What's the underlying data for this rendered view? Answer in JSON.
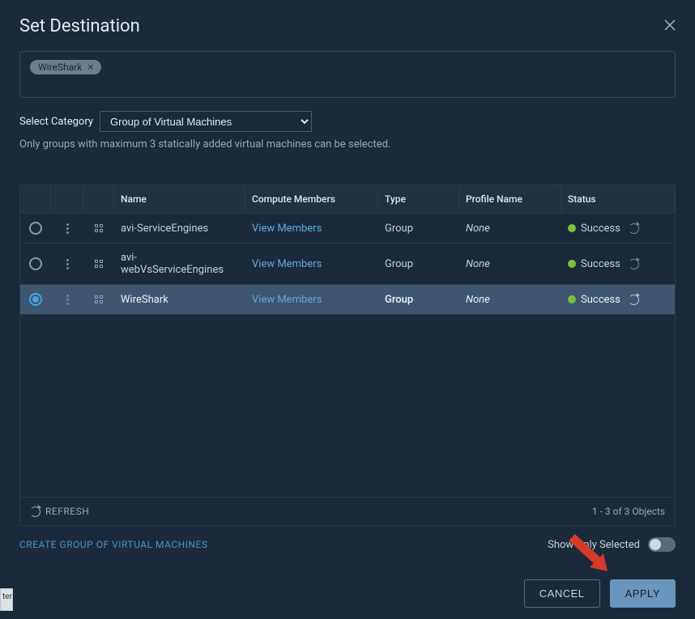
{
  "dialog": {
    "title": "Set Destination"
  },
  "chip": {
    "label": "WireShark"
  },
  "category": {
    "label": "Select Category",
    "value": "Group of Virtual Machines",
    "helper": "Only groups with maximum 3 statically added virtual machines can be selected."
  },
  "table": {
    "headers": {
      "name": "Name",
      "compute": "Compute Members",
      "type": "Type",
      "profile": "Profile Name",
      "status": "Status"
    },
    "rows": [
      {
        "name": "avi-ServiceEngines",
        "compute": "View Members",
        "type": "Group",
        "profile": "None",
        "status": "Success",
        "selected": false
      },
      {
        "name": "avi-webVsServiceEngines",
        "compute": "View Members",
        "type": "Group",
        "profile": "None",
        "status": "Success",
        "selected": false
      },
      {
        "name": "WireShark",
        "compute": "View Members",
        "type": "Group",
        "profile": "None",
        "status": "Success",
        "selected": true
      }
    ],
    "footer": {
      "refresh": "REFRESH",
      "count": "1 - 3 of 3 Objects"
    }
  },
  "below": {
    "create": "CREATE GROUP OF VIRTUAL MACHINES",
    "show_only": "Show Only Selected"
  },
  "buttons": {
    "cancel": "CANCEL",
    "apply": "APPLY"
  },
  "stub": {
    "text": "ter"
  }
}
